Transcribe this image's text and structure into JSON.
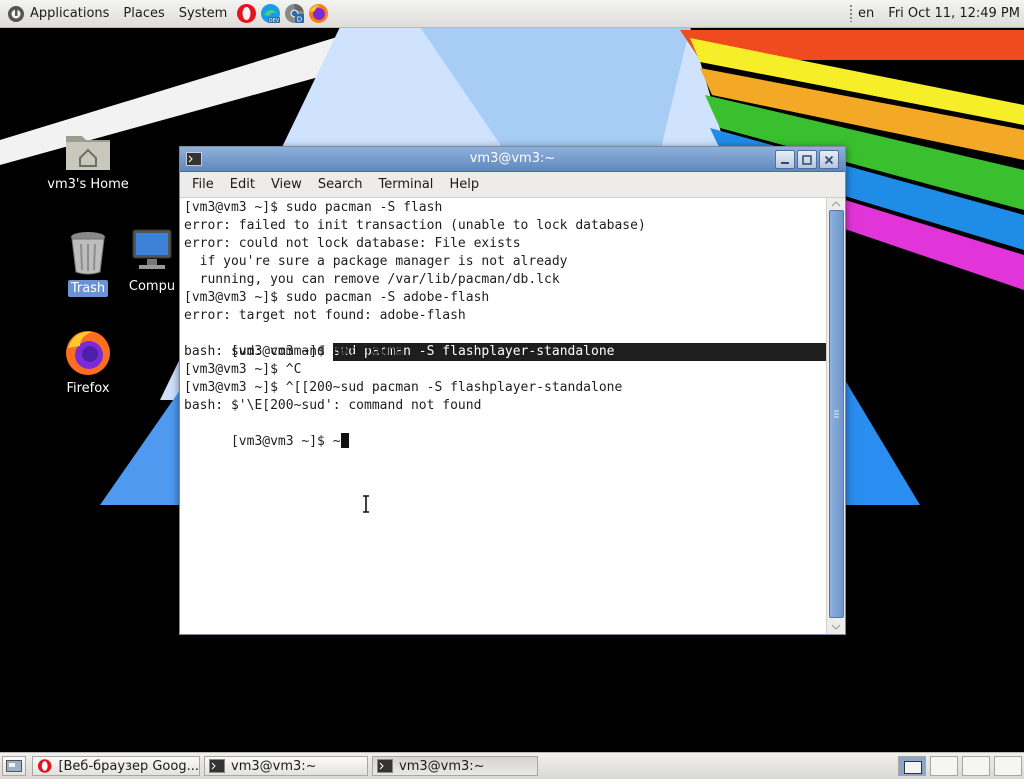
{
  "top_panel": {
    "menus": [
      "Applications",
      "Places",
      "System"
    ],
    "launchers": [
      "opera-icon",
      "edge-dev-icon",
      "chrome-dev-icon",
      "firefox-icon"
    ],
    "keyboard_layout": "en",
    "clock": "Fri Oct 11, 12:49 PM"
  },
  "desktop": {
    "icons": [
      {
        "name": "home-folder-icon",
        "label": "vm3's Home"
      },
      {
        "name": "trash-icon",
        "label": "Trash",
        "selected": true
      },
      {
        "name": "computer-icon",
        "label": "Compu"
      },
      {
        "name": "firefox-icon",
        "label": "Firefox"
      }
    ]
  },
  "terminal": {
    "title": "vm3@vm3:~",
    "menu": [
      "File",
      "Edit",
      "View",
      "Search",
      "Terminal",
      "Help"
    ],
    "lines": [
      "[vm3@vm3 ~]$ sudo pacman -S flash",
      "error: failed to init transaction (unable to lock database)",
      "error: could not lock database: File exists",
      "  if you're sure a package manager is not already",
      "  running, you can remove /var/lib/pacman/db.lck",
      "[vm3@vm3 ~]$ sudo pacman -S adobe-flash",
      "error: target not found: adobe-flash",
      "[vm3@vm3 ~]$ ",
      "bash: sud: command not found",
      "[vm3@vm3 ~]$ ^C",
      "[vm3@vm3 ~]$ ^[[200~sud pacman -S flashplayer-standalone",
      "bash: $'\\E[200~sud': command not found",
      "[vm3@vm3 ~]$ ~"
    ],
    "highlighted_command": "sud pacman -S flashplayer-standalone"
  },
  "taskbar": {
    "tasks": [
      {
        "label": "[Веб-браузер Goog...",
        "icon": "opera-icon"
      },
      {
        "label": "vm3@vm3:~",
        "icon": "terminal-icon"
      },
      {
        "label": "vm3@vm3:~",
        "icon": "terminal-icon"
      }
    ]
  },
  "colors": {
    "title_bar": "#6f96c8",
    "selection": "#1e1e1e",
    "accent": "#6a93d4"
  }
}
